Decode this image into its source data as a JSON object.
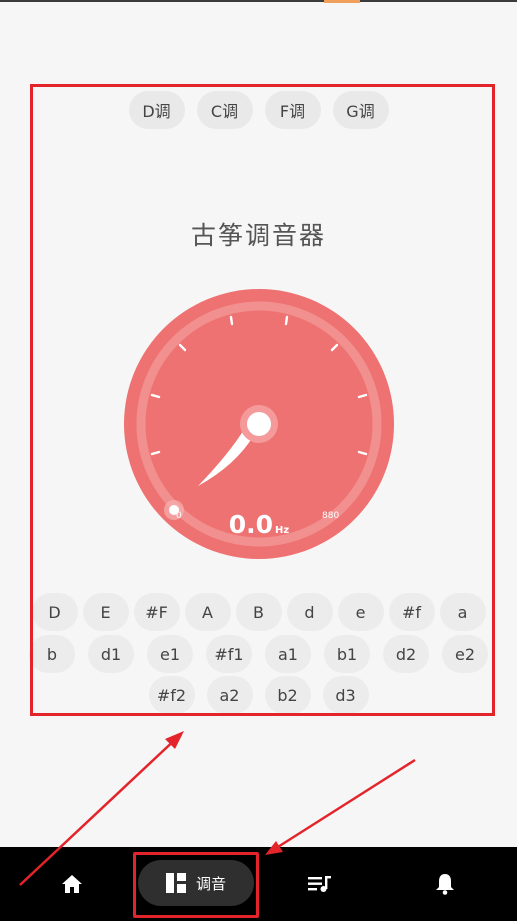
{
  "keys": [
    "D调",
    "C调",
    "F调",
    "G调"
  ],
  "title": "古筝调音器",
  "tuner": {
    "value": "0.0",
    "unit": "Hz",
    "min": "0",
    "max": "880",
    "dial_color": "#ee7272"
  },
  "notes": {
    "row1": [
      "D",
      "E",
      "#F",
      "A",
      "B",
      "d",
      "e",
      "#f",
      "a"
    ],
    "row2": [
      "b",
      "d1",
      "e1",
      "#f1",
      "a1",
      "b1",
      "d2",
      "e2"
    ],
    "row3": [
      "#f2",
      "a2",
      "b2",
      "d3"
    ]
  },
  "nav": {
    "items": [
      {
        "icon": "home-icon"
      },
      {
        "icon": "grid-icon",
        "label": "调音"
      },
      {
        "icon": "playlist-icon"
      },
      {
        "icon": "bell-icon"
      }
    ]
  },
  "annotation_color": "#e3242b"
}
